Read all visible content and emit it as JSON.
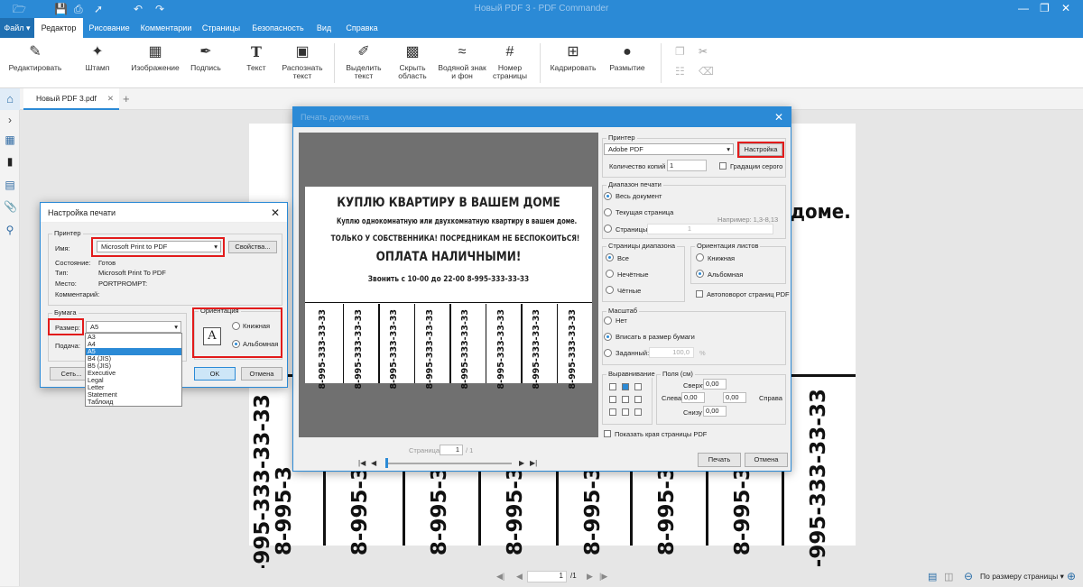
{
  "titlebar": {
    "title": "Новый PDF 3 - PDF Commander",
    "icons": [
      "folder-icon",
      "save-icon",
      "print-icon",
      "cursor-icon",
      "undo-icon",
      "redo-icon"
    ],
    "controls": [
      "minimize",
      "maximize",
      "close"
    ]
  },
  "menu": {
    "file": "Файл",
    "tabs": [
      "Редактор",
      "Рисование",
      "Комментарии",
      "Страницы",
      "Безопасность",
      "Вид",
      "Справка"
    ]
  },
  "ribbon": {
    "edit": "Редактировать",
    "stamp": "Штамп",
    "image": "Изображение",
    "signature": "Подпись",
    "text": "Текст",
    "recognize": "Распознать текст",
    "highlight": "Выделить текст",
    "hide_area": "Скрыть область",
    "watermark": "Водяной знак и фон",
    "page_number": "Номер страницы",
    "crop": "Кадрировать",
    "blur": "Размытие"
  },
  "doc_tab": {
    "label": "Новый PDF 3.pdf",
    "add": "+"
  },
  "document": {
    "right_heading": "доме.",
    "phone_number": "8-995-333-33-33",
    "partial_number": "8-995-3"
  },
  "statusbar": {
    "page_current": "1",
    "page_total": "/1",
    "zoom_label": "По размеру страницы"
  },
  "print_setup": {
    "title": "Настройка печати",
    "printer_group": "Принтер",
    "name_label": "Имя:",
    "name_value": "Microsoft Print to PDF",
    "properties_btn": "Свойства...",
    "status_label": "Состояние:",
    "status_value": "Готов",
    "type_label": "Тип:",
    "type_value": "Microsoft Print To PDF",
    "location_label": "Место:",
    "location_value": "PORTPROMPT:",
    "comment_label": "Комментарий:",
    "paper_group": "Бумага",
    "size_label": "Размер:",
    "size_value": "A5",
    "source_label": "Подача:",
    "size_options": [
      "A3",
      "A4",
      "A5",
      "B4 (JIS)",
      "B5 (JIS)",
      "Executive",
      "Legal",
      "Letter",
      "Statement",
      "Таблоид"
    ],
    "orientation_group": "Ориентация",
    "portrait": "Книжная",
    "landscape": "Альбомная",
    "network_btn": "Сеть...",
    "ok_btn": "OK",
    "cancel_btn": "Отмена"
  },
  "print_dialog": {
    "title": "Печать документа",
    "preview": {
      "line1": "КУПЛЮ КВАРТИРУ В ВАШЕМ ДОМЕ",
      "line2": "Куплю однокомнатную или двухкомнатную квартиру в вашем доме.",
      "line3": "ТОЛЬКО У СОБСТВЕННИКА! ПОСРЕДНИКАМ НЕ БЕСПОКОИТЬСЯ!",
      "line4": "ОПЛАТА НАЛИЧНЫМИ!",
      "line5": "Звонить с 10-00 до 22-00   8-995-333-33-33",
      "tab": "8-995-333-33-33"
    },
    "page_label": "Страница:",
    "page_value": "1",
    "page_total": "/ 1",
    "printer_group": "Принтер",
    "printer_value": "Adobe PDF",
    "setup_btn": "Настройка",
    "copies_label": "Количество копий",
    "copies_value": "1",
    "grayscale": "Градации серого",
    "range_group": "Диапазон печати",
    "range_all": "Весь документ",
    "range_current": "Текущая страница",
    "range_pages": "Страницы:",
    "range_pages_value": "1",
    "range_example": "Например: 1,3-8,13",
    "subset_group": "Страницы диапазона",
    "subset_all": "Все",
    "subset_odd": "Нечётные",
    "subset_even": "Чётные",
    "orient_group": "Ориентация листов",
    "orient_portrait": "Книжная",
    "orient_landscape": "Альбомная",
    "autorotate": "Автоповорот страниц PDF",
    "scale_group": "Масштаб",
    "scale_none": "Нет",
    "scale_fit": "Вписать в размер бумаги",
    "scale_custom": "Заданный:",
    "scale_value": "100,0",
    "scale_unit": "%",
    "align_group": "Выравнивание",
    "margins_group": "Поля (см)",
    "margin_top_label": "Сверху",
    "margin_top": "0,00",
    "margin_left_label": "Слева",
    "margin_left": "0,00",
    "margin_right_label": "Справа",
    "margin_right": "0,00",
    "margin_bottom_label": "Снизу",
    "margin_bottom": "0,00",
    "show_edges": "Показать края страницы PDF",
    "print_btn": "Печать",
    "cancel_btn": "Отмена"
  },
  "colors": {
    "accent": "#2b8ad6",
    "highlight": "#e21b1b"
  }
}
